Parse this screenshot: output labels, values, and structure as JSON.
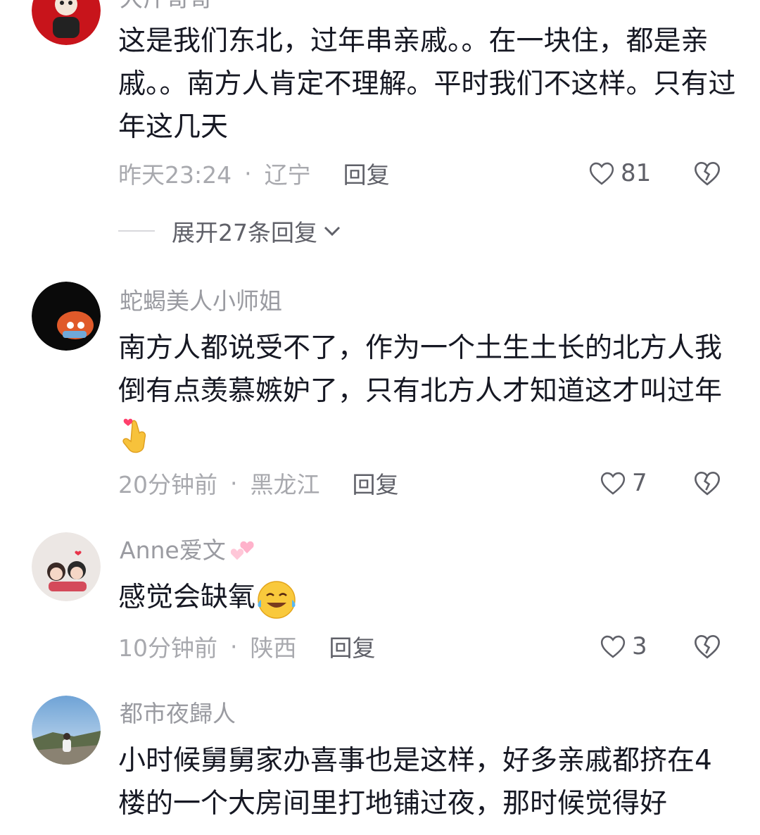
{
  "comments": [
    {
      "username": "大斤哥哥",
      "text": "这是我们东北，过年串亲戚。。在一块住，都是亲戚。。南方人肯定不理解。平时我们不这样。只有过年这几天",
      "time": "昨天23:24",
      "location": "辽宁",
      "reply_label": "回复",
      "likes": "81",
      "expand_label": "展开27条回复"
    },
    {
      "username": "蛇蝎美人小师姐",
      "text": "南方人都说受不了，作为一个土生土长的北方人我倒有点羡慕嫉妒了，只有北方人才知道这才叫过年",
      "time": "20分钟前",
      "location": "黑龙江",
      "reply_label": "回复",
      "likes": "7"
    },
    {
      "username": "Anne爱文",
      "text": "感觉会缺氧",
      "time": "10分钟前",
      "location": "陕西",
      "reply_label": "回复",
      "likes": "3"
    },
    {
      "username": "都市夜歸人",
      "text": "小时候舅舅家办喜事也是这样，好多亲戚都挤在4楼的一个大房间里打地铺过夜，那时候觉得好"
    }
  ],
  "meta_separator": "·",
  "icons": {
    "like": "heart-outline-icon",
    "dislike": "broken-heart-icon",
    "chevron": "chevron-down-icon"
  },
  "colors": {
    "text": "#161823",
    "secondary": "#a8a9ae",
    "reply": "#5f6068"
  }
}
